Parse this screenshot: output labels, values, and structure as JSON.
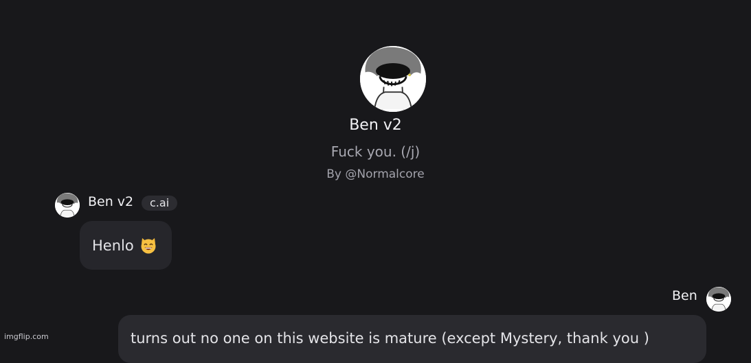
{
  "profile": {
    "name": "Ben v2",
    "tagline": "Fuck you. (/j)",
    "creator": "By @Normalcore",
    "avatar_icon": "character-avatar-icon"
  },
  "messages": [
    {
      "sender": "Ben v2",
      "badge": "c.ai",
      "text": "Henlo",
      "emoji_icon": "grinning-cat-emoji-icon"
    },
    {
      "sender": "Ben",
      "text": "turns out no one on this website is mature (except Mystery, thank you )"
    }
  ],
  "watermark": "imgflip.com",
  "colors": {
    "background": "#18181b",
    "bubble_bot": "#26262b",
    "bubble_user": "#2a2a2f",
    "badge": "#2c2c31"
  }
}
